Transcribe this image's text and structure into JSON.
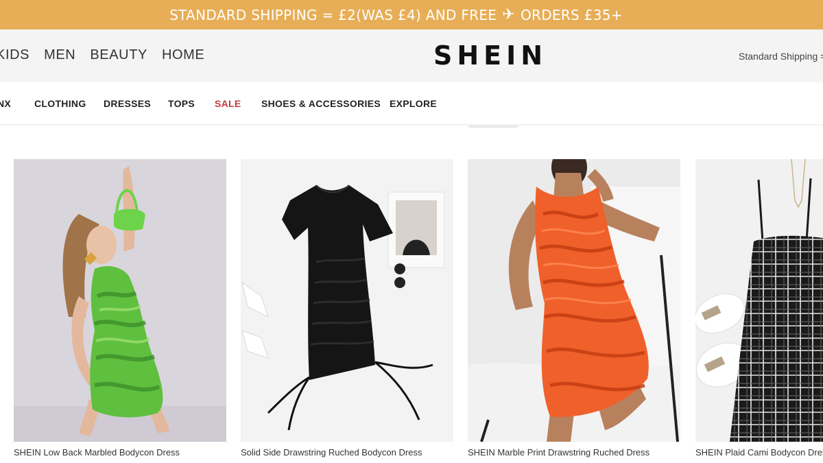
{
  "promo": {
    "text_before": "STANDARD SHIPPING = £2(WAS £4) AND FREE",
    "icon": "airplane-icon",
    "text_after": "ORDERS £35+",
    "bg_color": "#e7ae57"
  },
  "header": {
    "top_nav": [
      "KIDS",
      "MEN",
      "BEAUTY",
      "HOME"
    ],
    "logo": "SHEIN",
    "shipping_text": "Standard Shipping = £"
  },
  "category_nav": {
    "items": [
      "NX",
      "CLOTHING",
      "DRESSES",
      "TOPS",
      "SALE",
      "SHOES & ACCESSORIES",
      "EXPLORE"
    ],
    "sale_color": "#c23b3b"
  },
  "products": [
    {
      "title": "SHEIN Low Back Marbled Bodycon Dress",
      "color": "#5fbf3f"
    },
    {
      "title": "Solid Side Drawstring Ruched Bodycon Dress",
      "color": "#111111"
    },
    {
      "title": "SHEIN Marble Print Drawstring Ruched Dress",
      "color": "#f0602a"
    },
    {
      "title": "SHEIN Plaid Cami Bodycon Dress",
      "color": "#1a1a1a"
    }
  ]
}
